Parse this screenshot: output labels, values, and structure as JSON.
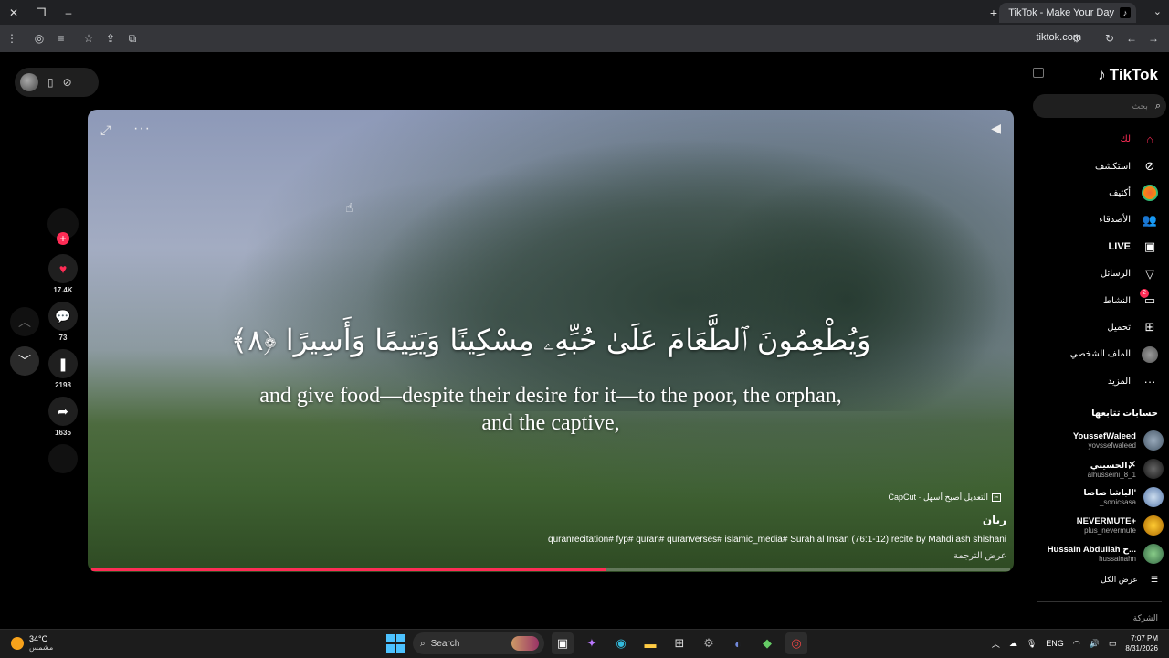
{
  "browser": {
    "tab_title": "TikTok - Make Your Day",
    "url": "tiktok.com"
  },
  "video": {
    "arabic_verse": "وَيُطْعِمُونَ ٱلطَّعَامَ عَلَىٰ حُبِّهِۦ مِسْكِينًا وَيَتِيمًا وَأَسِيرًا ﴿٨﴾",
    "english_translation": "and give food—despite their desire for it—to the poor, the orphan, and the captive,",
    "capcut_label": "CapCut · التعديل أصبح أسهل",
    "author": "ريان",
    "caption": "quranrecitation# fyp# quran# quranverses# islamic_media# Surah al Insan (76:1-12) recite by Mahdi ash shishani",
    "see_translation": "عرض الترجمة",
    "progress": 0.56
  },
  "actions": {
    "likes": "17.4K",
    "comments": "73",
    "saves": "2198",
    "shares": "1635"
  },
  "sidebar": {
    "logo": "TikTok",
    "search_placeholder": "بحث",
    "nav": [
      {
        "label": "لك",
        "icon": "home-icon"
      },
      {
        "label": "استكشف",
        "icon": "compass-icon"
      },
      {
        "label": "أكثيف",
        "icon": "explore-icon"
      },
      {
        "label": "الأصدقاء",
        "icon": "friends-icon"
      },
      {
        "label": "LIVE",
        "icon": "live-icon"
      },
      {
        "label": "الرسائل",
        "icon": "send-icon"
      },
      {
        "label": "النشاط",
        "icon": "activity-icon",
        "badge": "2"
      },
      {
        "label": "تحميل",
        "icon": "upload-icon"
      },
      {
        "label": "الملف الشخصي",
        "icon": "profile-icon"
      },
      {
        "label": "المزيد",
        "icon": "more-icon"
      }
    ],
    "following_title": "حسابات تتابعها",
    "accounts": [
      {
        "name": "YoussefWaleed",
        "handle": "yovssefwaleed"
      },
      {
        "name": "الحسيني〆",
        "handle": "alhusseini_8_1"
      },
      {
        "name": "الباشا صاصا'",
        "handle": "_sonicsasa"
      },
      {
        "name": "NEVERMUTE+",
        "handle": "plus_nevermute"
      },
      {
        "name": "Hussain Abdullah ح...",
        "handle": "hussainahn"
      }
    ],
    "see_all": "عرض الكل",
    "company": "الشركة"
  },
  "taskbar": {
    "temperature": "34°C",
    "condition": "مشمس",
    "search": "Search",
    "language": "ENG",
    "time": "7:07 PM",
    "date": "8/31/2026"
  },
  "colors": {
    "accent": "#fe2c55",
    "sidebar_bg": "#000000",
    "chrome_bg": "#202124"
  }
}
